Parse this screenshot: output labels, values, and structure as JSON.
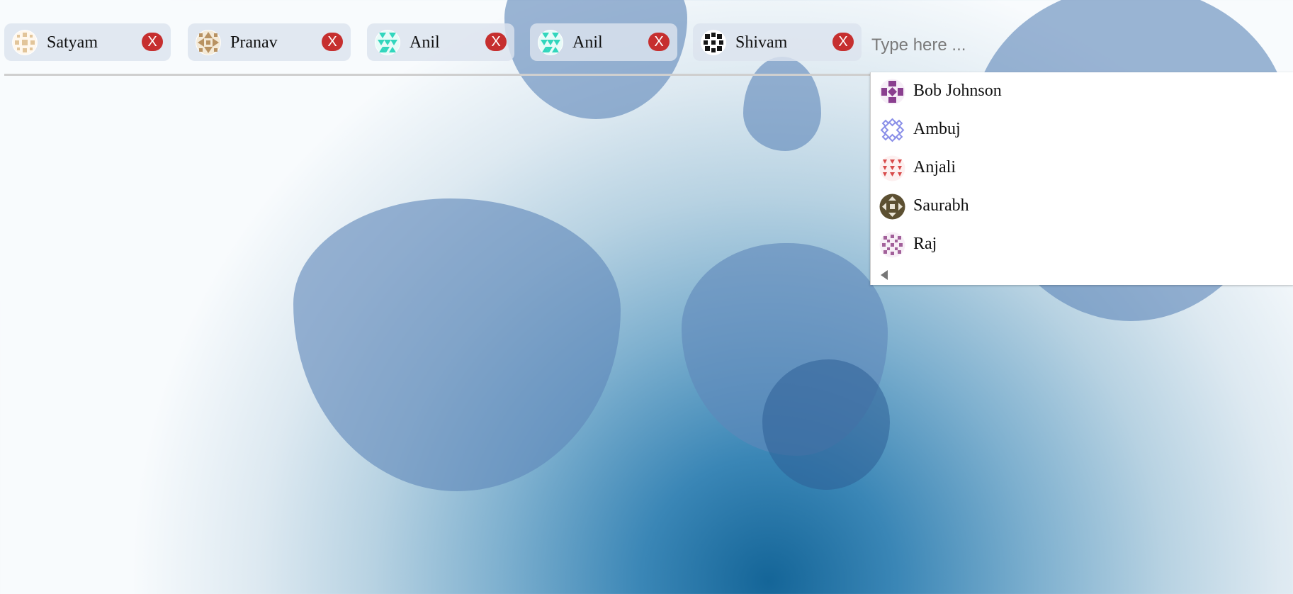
{
  "selected_chips": [
    {
      "name": "Satyam",
      "remove_label": "X",
      "avatar_color": "#e2c59a"
    },
    {
      "name": "Pranav",
      "remove_label": "X",
      "avatar_color": "#b89262"
    },
    {
      "name": "Anil",
      "remove_label": "X",
      "avatar_color": "#32d6bd"
    },
    {
      "name": "Anil",
      "remove_label": "X",
      "avatar_color": "#32d6bd"
    },
    {
      "name": "Shivam",
      "remove_label": "X",
      "avatar_color": "#161616"
    }
  ],
  "search": {
    "placeholder": "Type here ..."
  },
  "dropdown": {
    "options": [
      {
        "name": "Bob Johnson",
        "avatar_color": "#8a3f8f"
      },
      {
        "name": "Ambuj",
        "avatar_color": "#8a8fe8"
      },
      {
        "name": "Anjali",
        "avatar_color": "#d84a4a"
      },
      {
        "name": "Saurabh",
        "avatar_color": "#5c5032"
      },
      {
        "name": "Raj",
        "avatar_color": "#a2609a"
      }
    ]
  },
  "colors": {
    "remove_button": "#c62f2f",
    "chip_background": "#dce3ee",
    "background_center": "#146598"
  }
}
